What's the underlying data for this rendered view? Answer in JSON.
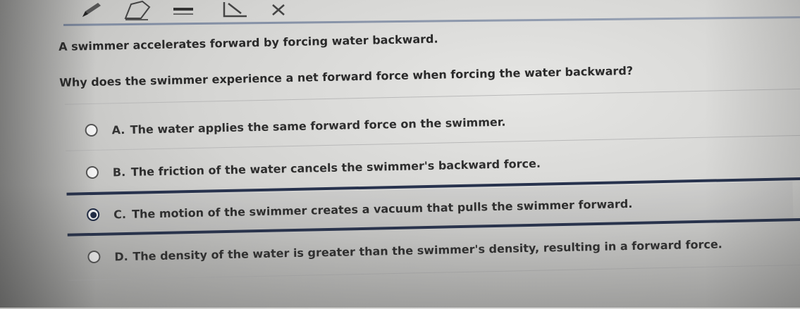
{
  "stem": "A swimmer accelerates forward by forcing water backward.",
  "question": "Why does the swimmer experience a net forward force when forcing the water backward?",
  "options": [
    {
      "letter": "A.",
      "text": "The water applies the same forward force on the swimmer.",
      "selected": false
    },
    {
      "letter": "B.",
      "text": "The friction of the water cancels the swimmer's backward force.",
      "selected": false
    },
    {
      "letter": "C.",
      "text": "The motion of the swimmer creates a vacuum that pulls the swimmer forward.",
      "selected": true
    },
    {
      "letter": "D.",
      "text": "The density of the water is greater than the swimmer's density, resulting in a forward force.",
      "selected": false
    }
  ],
  "toolbar": {
    "icons": [
      "pencil-icon",
      "eraser-icon",
      "strikethrough-icon",
      "line-reader-icon",
      "close-icon"
    ]
  },
  "colors": {
    "accent": "#27324d",
    "text": "#2b2b2b"
  }
}
